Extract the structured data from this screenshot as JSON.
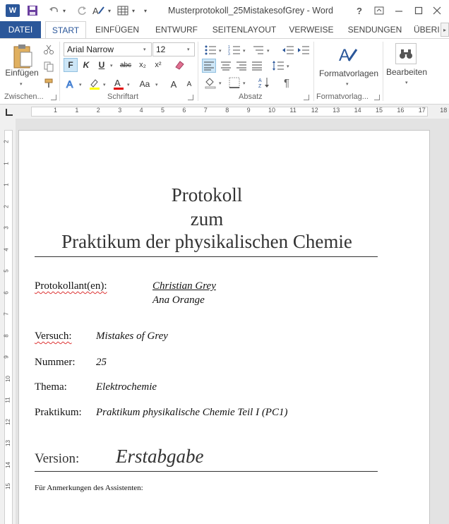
{
  "titlebar": {
    "app_icon": "W",
    "document_title": "Musterprotokoll_25MistakesofGrey - Word",
    "help": "?",
    "icons": [
      "word-app-icon",
      "save-icon",
      "undo-icon",
      "redo-icon",
      "format-icon",
      "table-icon"
    ]
  },
  "tabs": {
    "file": "DATEI",
    "start": "START",
    "insert": "EINFÜGEN",
    "design": "ENTWURF",
    "layout": "SEITENLAYOUT",
    "review": "VERWEISE",
    "mailings": "SENDUNGEN",
    "view": "ÜBERI"
  },
  "ribbon": {
    "clipboard": {
      "paste_label": "Einfügen",
      "group_label": "Zwischen..."
    },
    "font": {
      "font_name": "Arial Narrow",
      "font_size": "12",
      "bold": "F",
      "italic": "K",
      "underline": "U",
      "strike": "abc",
      "subscript": "x₂",
      "superscript": "x²",
      "case": "Aa",
      "grow": "A",
      "shrink": "A",
      "group_label": "Schriftart"
    },
    "paragraph": {
      "group_label": "Absatz",
      "pilcrow": "¶"
    },
    "styles": {
      "label": "Formatvorlagen",
      "group_label": "Formatvorlag..."
    },
    "editing": {
      "label": "Bearbeiten"
    }
  },
  "ruler": {
    "numbers": [
      "1",
      "1",
      "2",
      "3",
      "4",
      "5",
      "6",
      "7",
      "8",
      "9",
      "10",
      "11",
      "12",
      "13",
      "14",
      "15",
      "16",
      "17",
      "18"
    ]
  },
  "vruler": {
    "numbers": [
      "2",
      "1",
      "1",
      "2",
      "3",
      "4",
      "5",
      "6",
      "7",
      "8",
      "9",
      "10",
      "11",
      "12",
      "13",
      "14",
      "15"
    ]
  },
  "document": {
    "title_line1": "Protokoll",
    "title_line2": "zum",
    "title_line3": "Praktikum der physikalischen Chemie",
    "authors_label": "Protokollant(en):",
    "author1": "Christian Grey",
    "author2": "Ana Orange",
    "versuch_label": "Versuch:",
    "versuch_value": "Mistakes of Grey",
    "nummer_label": "Nummer:",
    "nummer_value": "25",
    "thema_label": "Thema:",
    "thema_value": "Elektrochemie",
    "praktikum_label": "Praktikum:",
    "praktikum_value": "Praktikum physikalische Chemie Teil I (PC1)",
    "version_label": "Version:",
    "version_value": "Erstabgabe",
    "notes_label": "Für Anmerkungen des Assistenten:"
  }
}
